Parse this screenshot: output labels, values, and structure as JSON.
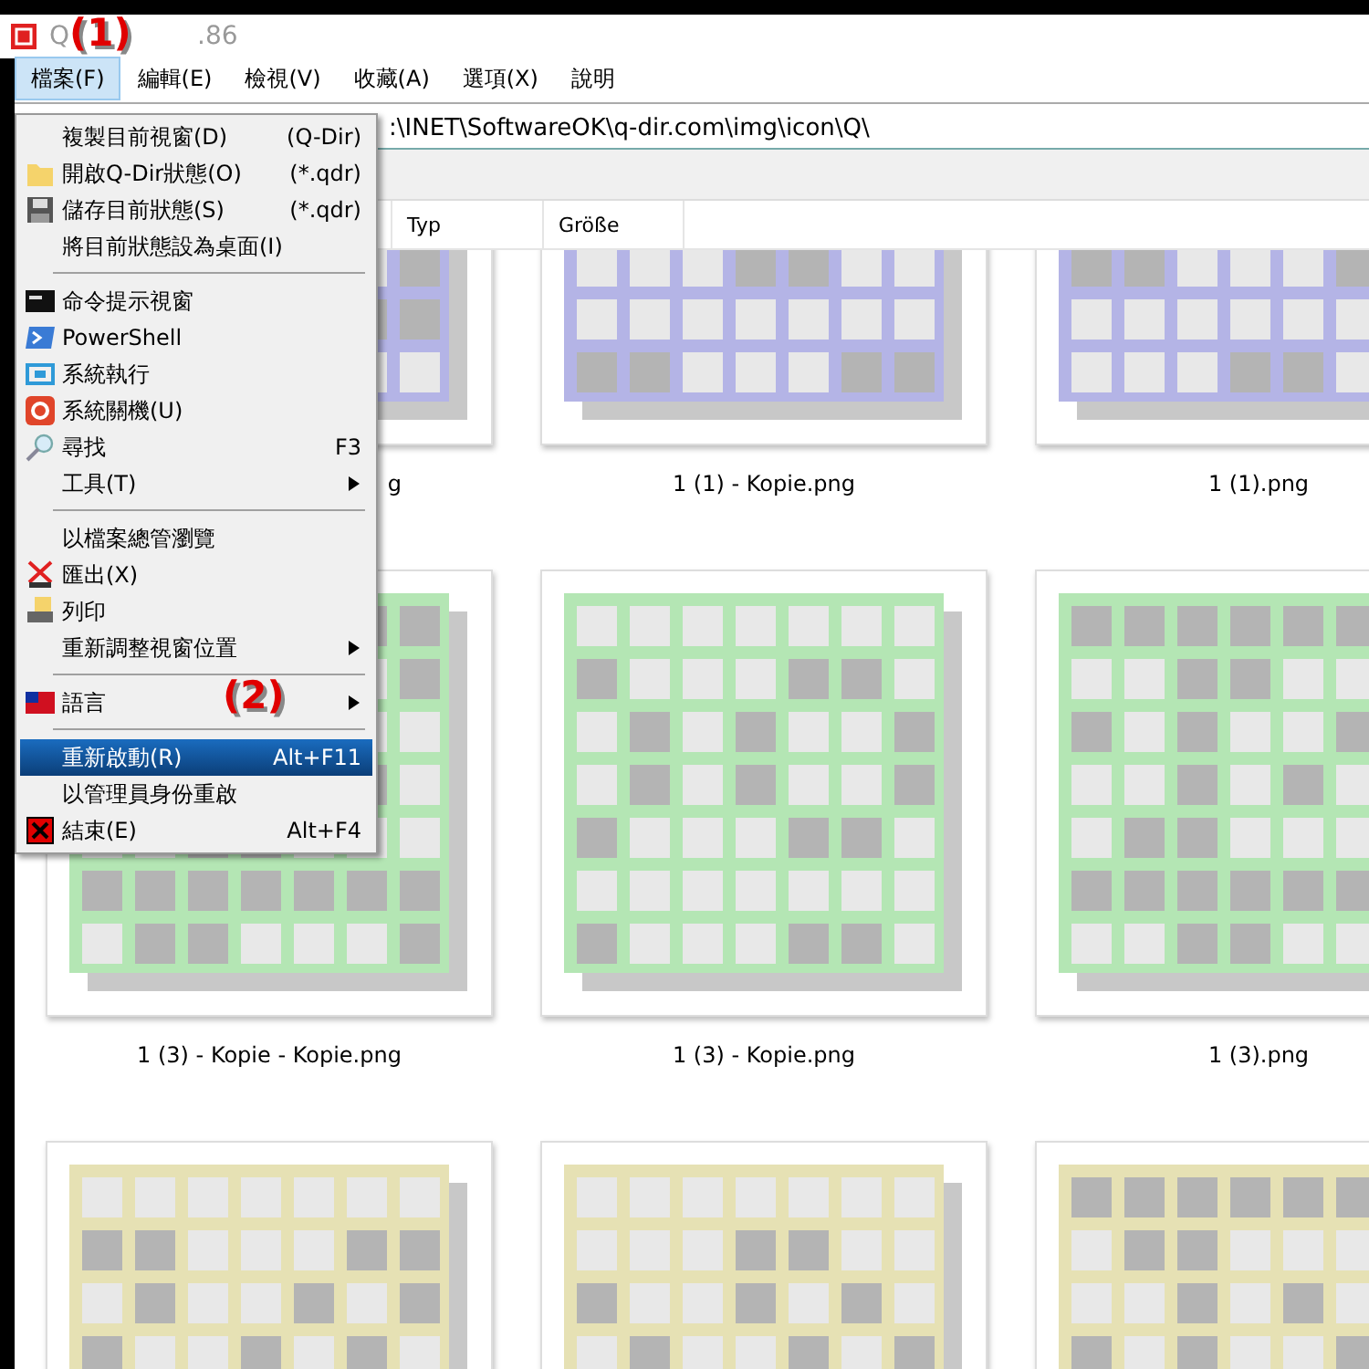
{
  "window": {
    "title_parts": [
      "Q",
      ".86"
    ]
  },
  "annotations": [
    {
      "label": "(1)"
    },
    {
      "label": "(2)"
    }
  ],
  "menubar": [
    {
      "label": "檔案(F)",
      "selected": true
    },
    {
      "label": "編輯(E)",
      "selected": false
    },
    {
      "label": "檢視(V)",
      "selected": false
    },
    {
      "label": "收藏(A)",
      "selected": false
    },
    {
      "label": "選項(X)",
      "selected": false
    },
    {
      "label": "說明",
      "selected": false
    }
  ],
  "address_bar": {
    "value": ":\\INET\\SoftwareOK\\q-dir.com\\img\\icon\\Q\\"
  },
  "columns": [
    "Typ",
    "Größe"
  ],
  "files": [
    {
      "name": "g",
      "color": "#b4b4e6"
    },
    {
      "name": "1 (1) - Kopie.png",
      "color": "#b4b4e6"
    },
    {
      "name": "1 (1).png",
      "color": "#b4b4e6"
    },
    {
      "name": "1 (3) - Kopie - Kopie.png",
      "color": "#b4e6b4"
    },
    {
      "name": "1 (3) - Kopie.png",
      "color": "#b4e6b4"
    },
    {
      "name": "1 (3).png",
      "color": "#b4e6b4"
    },
    {
      "color": "#e6e1b4"
    },
    {
      "color": "#e6e1b4"
    },
    {
      "color": "#e6e1b4"
    }
  ],
  "menu": {
    "items": [
      {
        "kind": "item",
        "label": "複製目前視窗(D)",
        "shortcut": "(Q-Dir)",
        "selected": false
      },
      {
        "kind": "item",
        "label": "開啟Q-Dir狀態(O)",
        "shortcut": "(*.qdr)",
        "selected": false
      },
      {
        "kind": "item",
        "label": "儲存目前狀態(S)",
        "shortcut": "(*.qdr)",
        "selected": false
      },
      {
        "kind": "item",
        "label": "將目前狀態設為桌面(I)",
        "selected": false
      },
      {
        "kind": "separator"
      },
      {
        "kind": "item",
        "label": "命令提示視窗",
        "selected": false
      },
      {
        "kind": "item",
        "label": "PowerShell",
        "selected": false
      },
      {
        "kind": "item",
        "label": "系統執行",
        "selected": false
      },
      {
        "kind": "item",
        "label": "系統關機(U)",
        "selected": false
      },
      {
        "kind": "item",
        "label": "尋找",
        "shortcut": "F3",
        "selected": false
      },
      {
        "kind": "item",
        "label": "工具(T)",
        "submenu": true,
        "selected": false
      },
      {
        "kind": "separator"
      },
      {
        "kind": "item",
        "label": "以檔案總管瀏覽",
        "selected": false
      },
      {
        "kind": "item",
        "label": "匯出(X)",
        "selected": false
      },
      {
        "kind": "item",
        "label": "列印",
        "selected": false
      },
      {
        "kind": "item",
        "label": "重新調整視窗位置",
        "submenu": true,
        "selected": false
      },
      {
        "kind": "separator"
      },
      {
        "kind": "item",
        "label": "語言",
        "submenu": true,
        "selected": false
      },
      {
        "kind": "separator"
      },
      {
        "kind": "item",
        "label": "重新啟動(R)",
        "shortcut": "Alt+F11",
        "selected": true
      },
      {
        "kind": "item",
        "label": "以管理員身份重啟",
        "selected": false
      },
      {
        "kind": "item",
        "label": "結束(E)",
        "shortcut": "Alt+F4",
        "selected": false
      }
    ]
  }
}
